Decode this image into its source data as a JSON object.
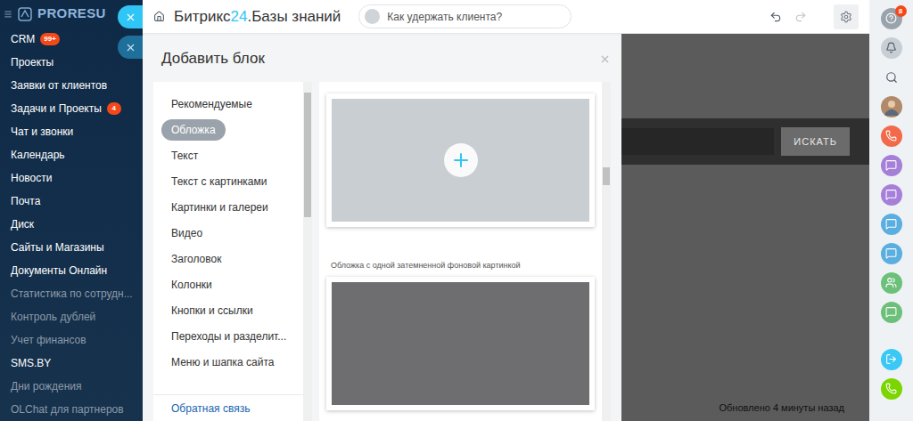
{
  "sidebar": {
    "logo": "PRORESU",
    "items": [
      {
        "label": "CRM",
        "badge": "99+",
        "dimmed": false
      },
      {
        "label": "Проекты",
        "badge": "",
        "dimmed": false
      },
      {
        "label": "Заявки от клиентов",
        "badge": "",
        "dimmed": false
      },
      {
        "label": "Задачи и Проекты",
        "badge": "4",
        "dimmed": false
      },
      {
        "label": "Чат и звонки",
        "badge": "",
        "dimmed": false
      },
      {
        "label": "Календарь",
        "badge": "",
        "dimmed": false
      },
      {
        "label": "Новости",
        "badge": "",
        "dimmed": false
      },
      {
        "label": "Почта",
        "badge": "",
        "dimmed": false
      },
      {
        "label": "Диск",
        "badge": "",
        "dimmed": false
      },
      {
        "label": "Сайты и Магазины",
        "badge": "",
        "dimmed": false
      },
      {
        "label": "Документы Онлайн",
        "badge": "",
        "dimmed": false
      },
      {
        "label": "Статистика по сотрудн...",
        "badge": "",
        "dimmed": true
      },
      {
        "label": "Контроль дублей",
        "badge": "",
        "dimmed": true
      },
      {
        "label": "Учет финансов",
        "badge": "",
        "dimmed": true
      },
      {
        "label": "SMS.BY",
        "badge": "",
        "dimmed": false
      },
      {
        "label": "Дни рождения",
        "badge": "",
        "dimmed": true
      },
      {
        "label": "OLChat для партнеров",
        "badge": "",
        "dimmed": true
      }
    ]
  },
  "header": {
    "brand": "Битрикс",
    "accent": "24",
    "section": ".Базы знаний",
    "search_placeholder": "Как удержать клиента?"
  },
  "panel": {
    "title": "Добавить блок",
    "categories": [
      {
        "label": "Рекомендуемые",
        "selected": false
      },
      {
        "label": "Обложка",
        "selected": true
      },
      {
        "label": "Текст",
        "selected": false
      },
      {
        "label": "Текст с картинками",
        "selected": false
      },
      {
        "label": "Картинки и галереи",
        "selected": false
      },
      {
        "label": "Видео",
        "selected": false
      },
      {
        "label": "Заголовок",
        "selected": false
      },
      {
        "label": "Колонки",
        "selected": false
      },
      {
        "label": "Кнопки и ссылки",
        "selected": false
      },
      {
        "label": "Переходы и разделит...",
        "selected": false
      },
      {
        "label": "Меню и шапка сайта",
        "selected": false
      }
    ],
    "feedback": "Обратная связь",
    "blocks": [
      {
        "caption": "",
        "hovered": true,
        "tone": "#c9ced3"
      },
      {
        "caption": "Обложка с одной затемненной фоновой картинкой",
        "hovered": false,
        "tone": "#6e6e70"
      }
    ]
  },
  "page": {
    "search_button": "ИСКАТЬ",
    "updated": "Обновлено 4 минуты назад"
  },
  "rail": [
    {
      "kind": "help",
      "color": "#9aa3ab",
      "badge": "8"
    },
    {
      "kind": "bell",
      "color": "#c7ced4",
      "badge": ""
    },
    {
      "kind": "search",
      "color": "#eef2f4",
      "badge": ""
    },
    {
      "kind": "avatar",
      "color": "#b08a6a",
      "badge": ""
    },
    {
      "kind": "phone",
      "color": "#f26a4b",
      "badge": ""
    },
    {
      "kind": "chat",
      "color": "#a57fd8",
      "badge": ""
    },
    {
      "kind": "chat",
      "color": "#a57fd8",
      "badge": ""
    },
    {
      "kind": "chat",
      "color": "#5aaee0",
      "badge": ""
    },
    {
      "kind": "chat",
      "color": "#5aaee0",
      "badge": ""
    },
    {
      "kind": "group",
      "color": "#6cc07a",
      "badge": ""
    },
    {
      "kind": "chat",
      "color": "#6cc07a",
      "badge": ""
    },
    {
      "kind": "exit",
      "color": "#3bc8f5",
      "badge": ""
    },
    {
      "kind": "call",
      "color": "#7bd500",
      "badge": ""
    }
  ]
}
